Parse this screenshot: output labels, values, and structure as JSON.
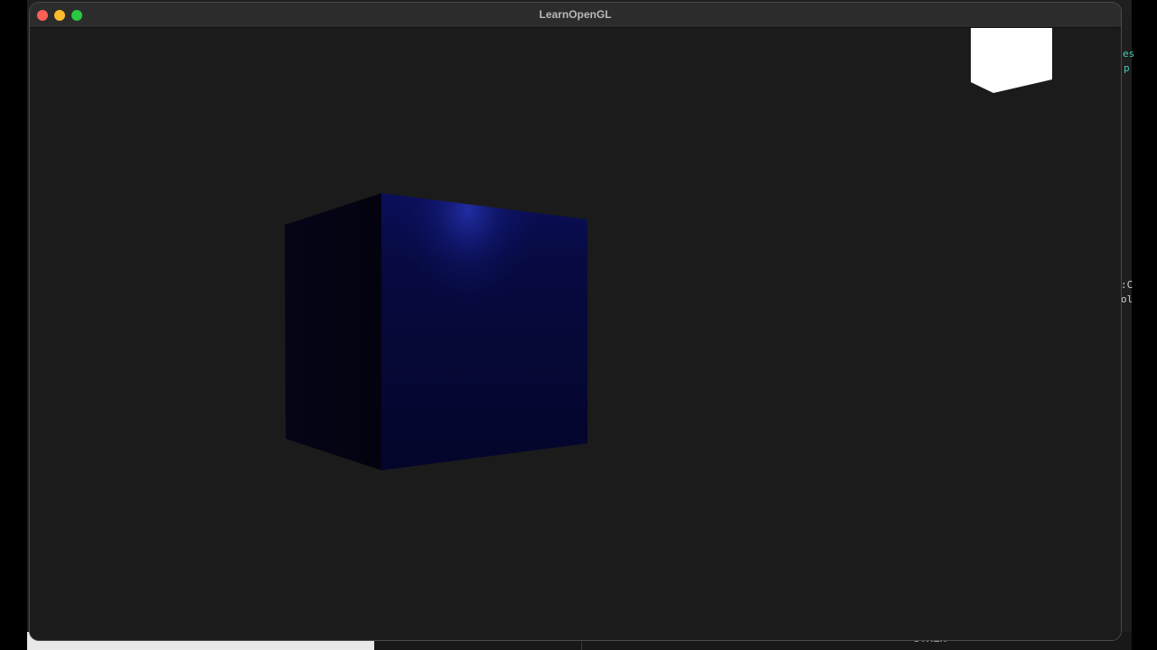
{
  "window": {
    "title": "LearnOpenGL"
  },
  "background_editor": {
    "fragments": [
      ":C",
      "ol",
      "es",
      "p"
    ],
    "panel_label": "OTHER"
  },
  "scene": {
    "clear_color": "#1b1b1b",
    "objects": [
      {
        "name": "lit-cube",
        "color": "#0a0f66",
        "shading": "blinn-phong with specular highlight"
      },
      {
        "name": "light-source-cube",
        "color": "#ffffff"
      }
    ]
  },
  "colors": {
    "close": "#fe5f57",
    "minimize": "#febc2e",
    "maximize": "#28c840",
    "titlebar": "#2c2c2c"
  }
}
